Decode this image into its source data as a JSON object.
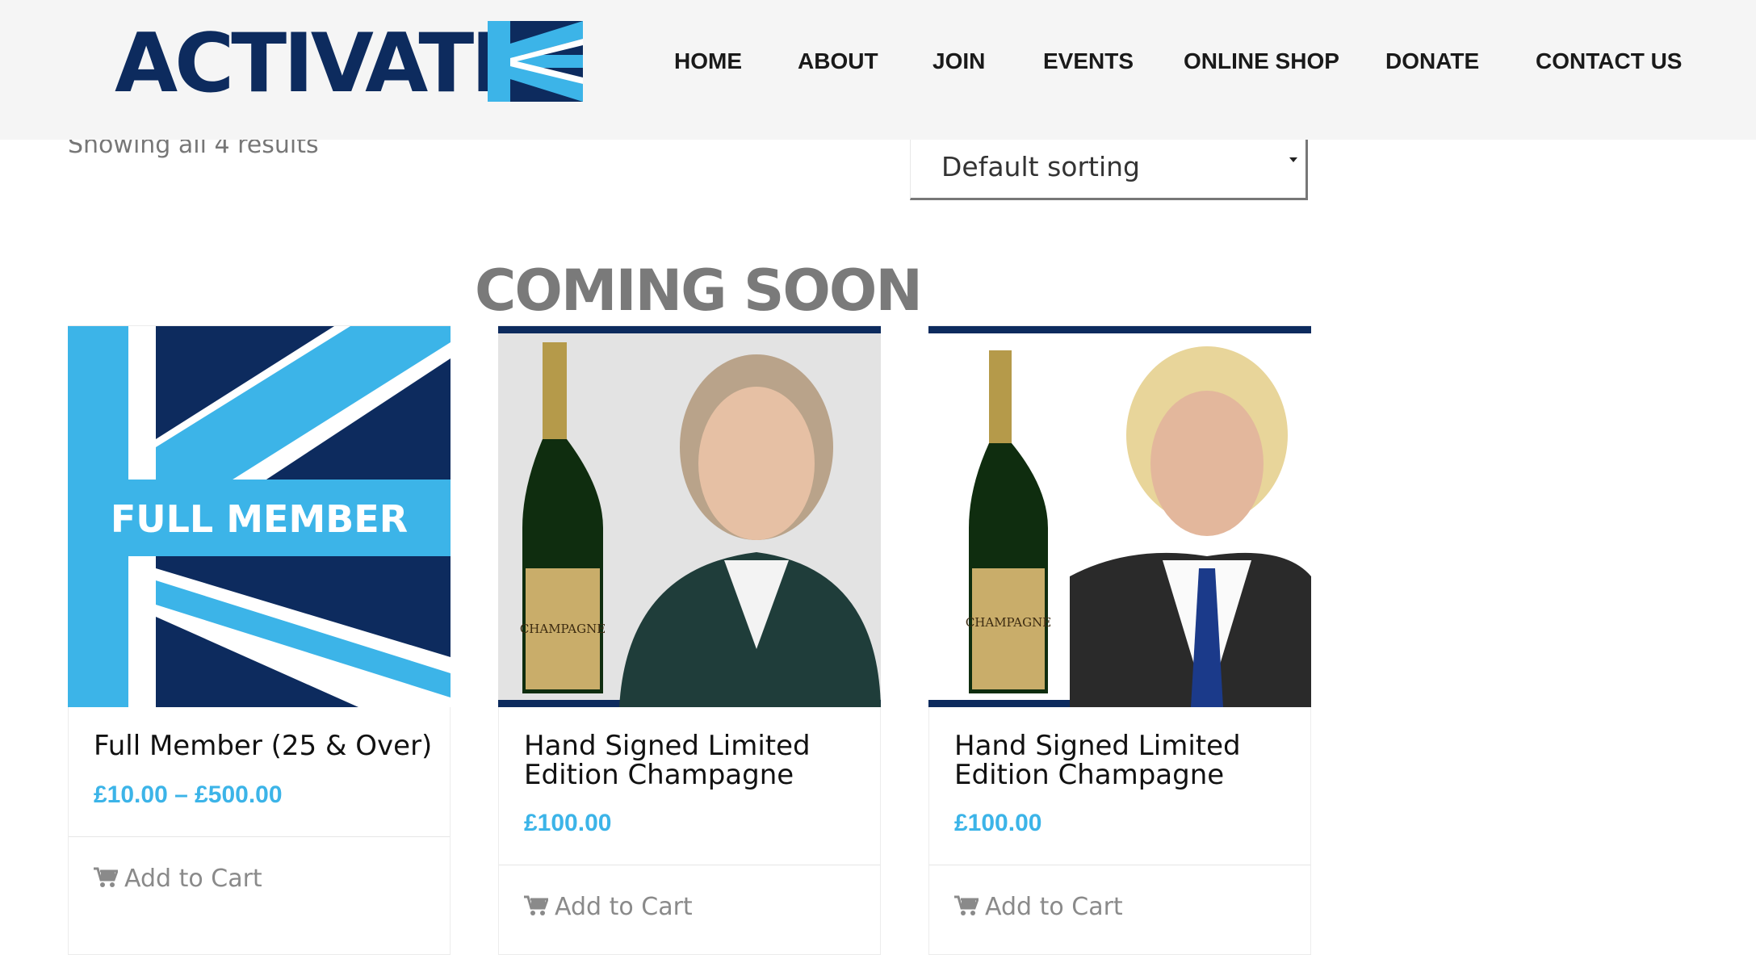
{
  "brand": {
    "logo_text": "ACTIVATE",
    "primary_color": "#0d2b5e",
    "accent_color": "#3cb4e8"
  },
  "nav": {
    "items": [
      {
        "label": "HOME"
      },
      {
        "label": "ABOUT"
      },
      {
        "label": "JOIN"
      },
      {
        "label": "EVENTS"
      },
      {
        "label": "ONLINE SHOP"
      },
      {
        "label": "DONATE"
      },
      {
        "label": "CONTACT US"
      }
    ]
  },
  "shop": {
    "result_count": "Showing all 4 results",
    "sorting": {
      "selected": "Default sorting"
    },
    "banner": "COMING SOON",
    "products": [
      {
        "image_label": "FULL MEMBER",
        "title": "Full Member (25 & Over)",
        "price": "£10.00 – £500.00",
        "cart_label": "Add to Cart"
      },
      {
        "image_label": "CHAMPAGNE",
        "title": "Hand Signed Limited Edition Champagne",
        "price": "£100.00",
        "cart_label": "Add to Cart"
      },
      {
        "image_label": "CHAMPAGNE",
        "title": "Hand Signed Limited Edition Champagne",
        "price": "£100.00",
        "cart_label": "Add to Cart"
      }
    ]
  }
}
